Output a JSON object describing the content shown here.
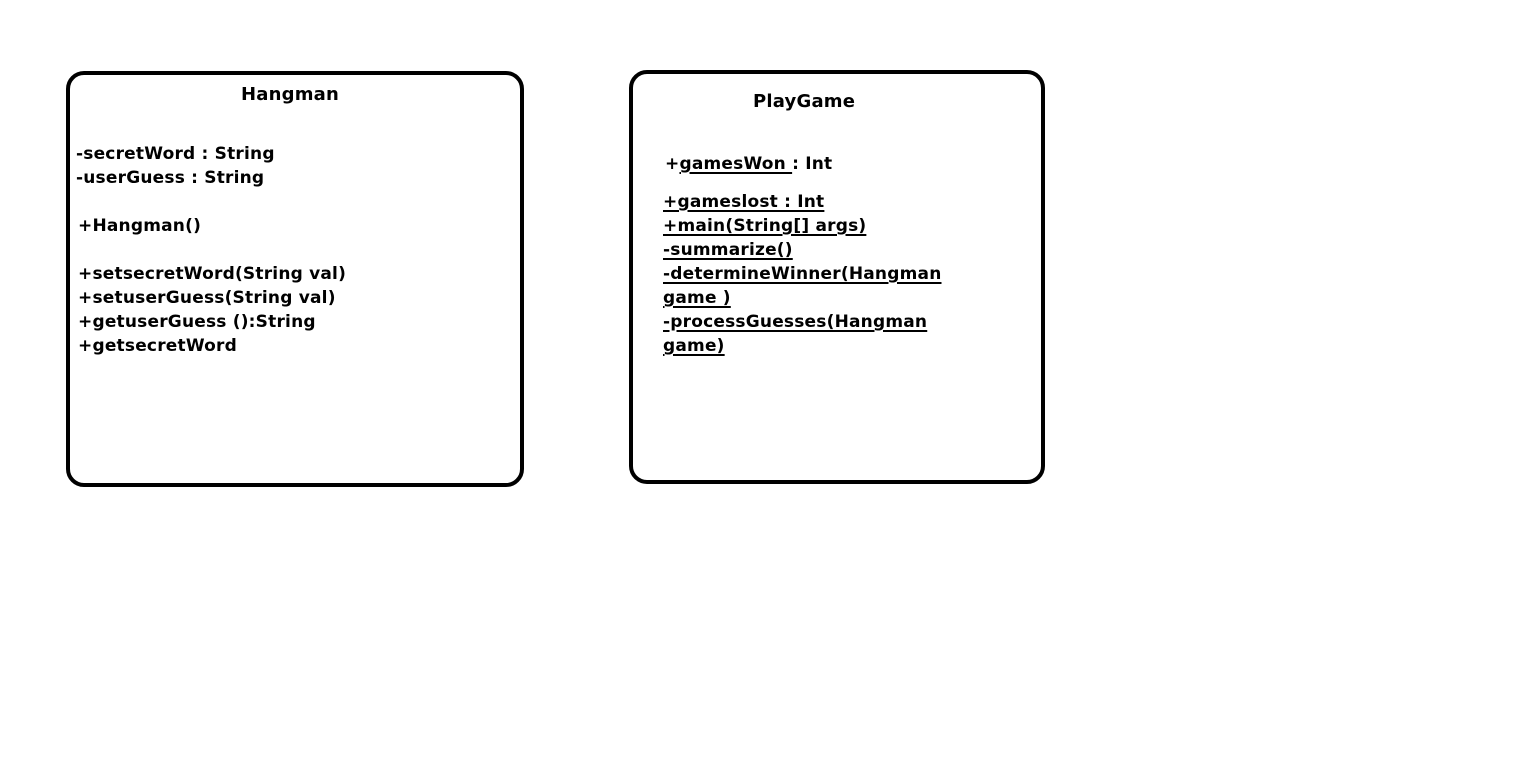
{
  "hangman": {
    "title": "Hangman",
    "fields": [
      "-secretWord : String",
      "-userGuess : String"
    ],
    "constructor": "+Hangman()",
    "methods": [
      "+setsecretWord(String val)",
      "+setuserGuess(String val)",
      "+getuserGuess ():String",
      "+getsecretWord"
    ]
  },
  "playgame": {
    "title": "PlayGame",
    "games_won_prefix": "+",
    "games_won_name": "gamesWon ",
    "games_won_type": ": Int",
    "games_lost": "+gameslost : Int",
    "main": "+main(String[] args)",
    "summarize": "-summarize()",
    "determine_winner_line1": "-determineWinner(Hangman",
    "determine_winner_line2": "game )",
    "process_guesses_line1": "-processGuesses(Hangman",
    "process_guesses_line2": "game)"
  }
}
